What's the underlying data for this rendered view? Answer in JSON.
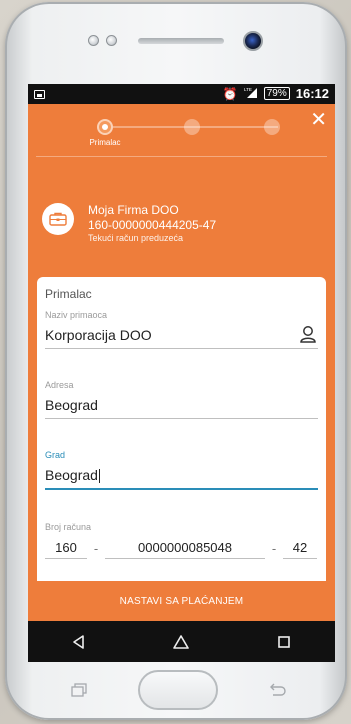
{
  "status_bar": {
    "alarm_icon": "alarm-icon",
    "signal_label": "LTE",
    "battery": "79%",
    "time": "16:12"
  },
  "stepper": {
    "active_step_label": "Primalac",
    "steps_total": 3,
    "active_step": 1
  },
  "account": {
    "name": "Moja Firma DOO",
    "number": "160-0000000444205-47",
    "type": "Tekući račun preduzeća"
  },
  "form": {
    "title": "Primalac",
    "recipient_name": {
      "label": "Naziv primaoca",
      "value": "Korporacija DOO"
    },
    "address": {
      "label": "Adresa",
      "value": "Beograd"
    },
    "city": {
      "label": "Grad",
      "value": "Beograd"
    },
    "account_number": {
      "label": "Broj računa",
      "bank": "160",
      "number": "0000000085048",
      "control": "42",
      "separator": "-"
    }
  },
  "cta": {
    "label": "NASTAVI SA PLAĆANJEM"
  },
  "colors": {
    "brand_orange": "#ee7d3b",
    "focus_blue": "#2a8db8"
  }
}
